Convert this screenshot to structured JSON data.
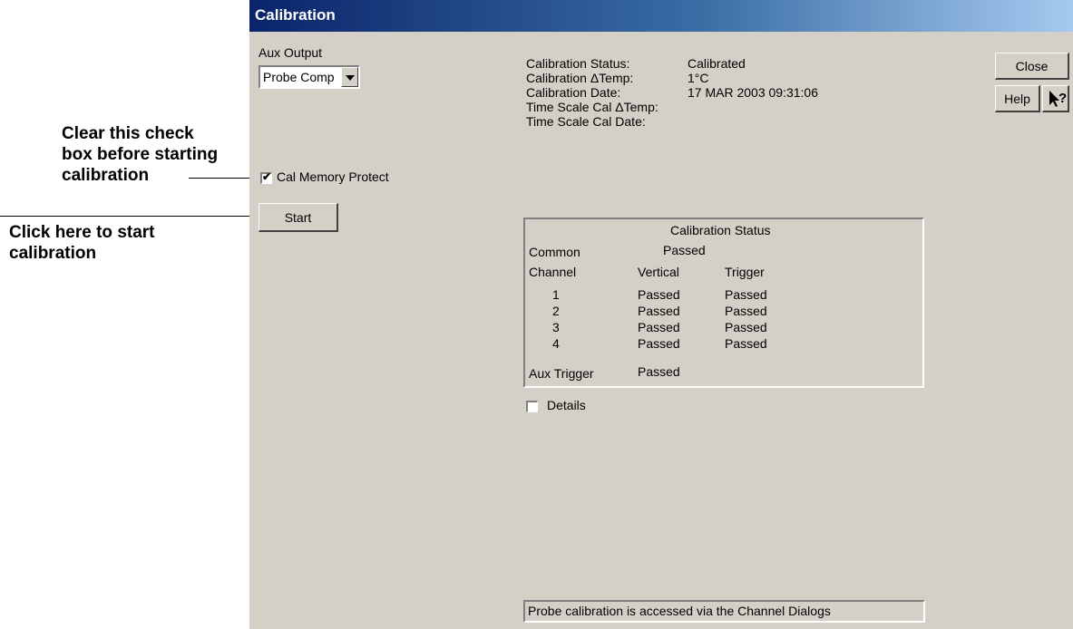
{
  "annotations": {
    "clear_checkbox": [
      "Clear this check",
      "box before starting",
      "calibration"
    ],
    "start_calibration": [
      "Click here to start",
      "calibration"
    ]
  },
  "window": {
    "title": "Calibration"
  },
  "aux_output": {
    "label": "Aux Output",
    "selected": "Probe Comp"
  },
  "cal_memory_protect": {
    "label": "Cal Memory Protect",
    "checked": true
  },
  "start_button": "Start",
  "close_button": "Close",
  "help_button": "Help",
  "whats_this_icon": "whats-this-arrow-question",
  "status_info": [
    {
      "label": "Calibration Status:",
      "value": "Calibrated"
    },
    {
      "label": "Calibration ΔTemp:",
      "value": "1°C"
    },
    {
      "label": "Calibration Date:",
      "value": "17 MAR 2003 09:31:06"
    },
    {
      "label": "Time Scale Cal ΔTemp:",
      "value": ""
    },
    {
      "label": "Time Scale Cal Date:",
      "value": ""
    }
  ],
  "cal_status_box": {
    "title": "Calibration Status",
    "common_label": "Common",
    "common_value": "Passed",
    "headers": {
      "channel": "Channel",
      "vertical": "Vertical",
      "trigger": "Trigger"
    },
    "rows": [
      {
        "channel": "1",
        "vertical": "Passed",
        "trigger": "Passed"
      },
      {
        "channel": "2",
        "vertical": "Passed",
        "trigger": "Passed"
      },
      {
        "channel": "3",
        "vertical": "Passed",
        "trigger": "Passed"
      },
      {
        "channel": "4",
        "vertical": "Passed",
        "trigger": "Passed"
      }
    ],
    "aux_trigger_label": "Aux Trigger",
    "aux_trigger_value": "Passed"
  },
  "details": {
    "label": "Details",
    "checked": false
  },
  "status_bar": "Probe calibration is accessed via the Channel Dialogs",
  "colors": {
    "dialog_bg": "#d4d0c8",
    "titlebar_start": "#0a246a",
    "titlebar_end": "#a6caf0"
  }
}
